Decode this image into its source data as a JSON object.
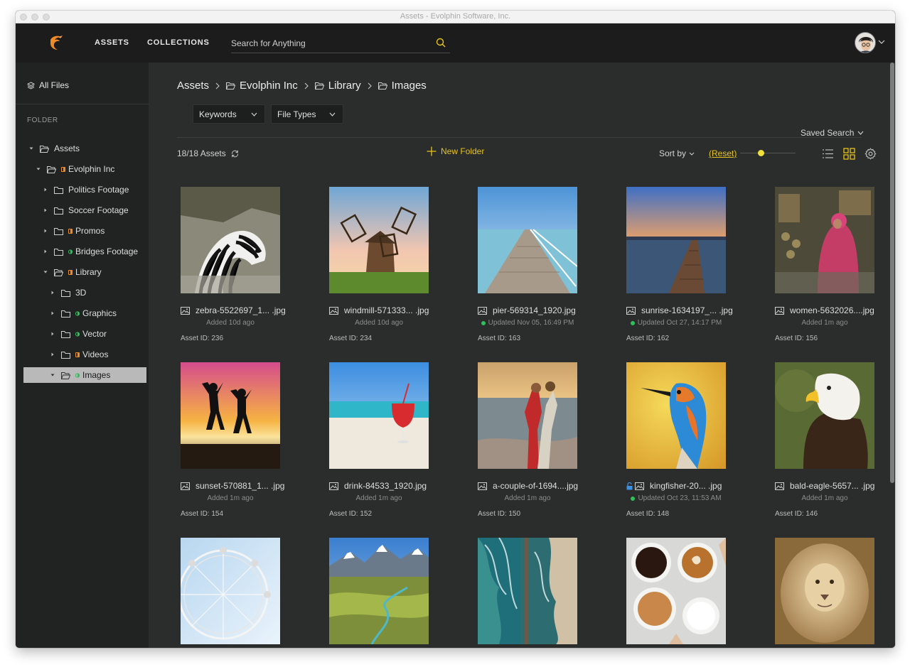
{
  "window": {
    "title": "Assets - Evolphin Software, Inc."
  },
  "nav": {
    "assets": "ASSETS",
    "collections": "COLLECTIONS"
  },
  "search": {
    "placeholder": "Search for Anything",
    "value": ""
  },
  "sidebar": {
    "all_files": "All Files",
    "folder_heading": "FOLDER",
    "tree": [
      {
        "label": "Assets",
        "level": 0,
        "expanded": true,
        "badge": ""
      },
      {
        "label": "Evolphin Inc",
        "level": 1,
        "expanded": true,
        "badge": "orange"
      },
      {
        "label": "Politics Footage",
        "level": 2,
        "expanded": false,
        "badge": ""
      },
      {
        "label": "Soccer Footage",
        "level": 2,
        "expanded": false,
        "badge": ""
      },
      {
        "label": "Promos",
        "level": 2,
        "expanded": false,
        "badge": "orange"
      },
      {
        "label": "Bridges Footage",
        "level": 2,
        "expanded": false,
        "badge": "green"
      },
      {
        "label": "Library",
        "level": 2,
        "expanded": true,
        "badge": "orange"
      },
      {
        "label": "3D",
        "level": 3,
        "expanded": false,
        "badge": ""
      },
      {
        "label": "Graphics",
        "level": 3,
        "expanded": false,
        "badge": "green"
      },
      {
        "label": "Vector",
        "level": 3,
        "expanded": false,
        "badge": "green"
      },
      {
        "label": "Videos",
        "level": 3,
        "expanded": false,
        "badge": "orange"
      },
      {
        "label": "Images",
        "level": 3,
        "expanded": true,
        "badge": "green",
        "selected": true
      }
    ]
  },
  "breadcrumb": [
    "Assets",
    "Evolphin Inc",
    "Library",
    "Images"
  ],
  "filters": {
    "keywords": "Keywords",
    "file_types": "File Types",
    "saved_search": "Saved Search"
  },
  "toolbar": {
    "asset_count": "18/18 Assets",
    "new_folder": "New Folder",
    "sort_by": "Sort by",
    "reset": "(Reset)",
    "thumb_size_level": 0.37,
    "active_view": "grid"
  },
  "colors": {
    "accent": "#e8c318",
    "status_green": "#2ec05a",
    "badge_orange": "#f08a24",
    "badge_green": "#2ec05a"
  },
  "assets": [
    {
      "name": "zebra-5522697_1... .jpg",
      "status": "Added 10d ago",
      "updated": false,
      "locked": false,
      "id": "Asset ID: 236",
      "thumb": "zebra"
    },
    {
      "name": "windmill-571333... .jpg",
      "status": "Added 10d ago",
      "updated": false,
      "locked": false,
      "id": "Asset ID: 234",
      "thumb": "windmill"
    },
    {
      "name": "pier-569314_1920.jpg",
      "status": "Updated Nov 05, 16:49 PM",
      "updated": true,
      "locked": false,
      "id": "Asset ID: 163",
      "thumb": "pier"
    },
    {
      "name": "sunrise-1634197_... .jpg",
      "status": "Updated Oct 27, 14:17 PM",
      "updated": true,
      "locked": false,
      "id": "Asset ID: 162",
      "thumb": "sunrise"
    },
    {
      "name": "women-5632026....jpg",
      "status": "Added 1m ago",
      "updated": false,
      "locked": false,
      "id": "Asset ID: 156",
      "thumb": "women"
    },
    {
      "name": "sunset-570881_1... .jpg",
      "status": "Added 1m ago",
      "updated": false,
      "locked": false,
      "id": "Asset ID: 154",
      "thumb": "sunset"
    },
    {
      "name": "drink-84533_1920.jpg",
      "status": "Added 1m ago",
      "updated": false,
      "locked": false,
      "id": "Asset ID: 152",
      "thumb": "drink"
    },
    {
      "name": "a-couple-of-1694....jpg",
      "status": "Added 1m ago",
      "updated": false,
      "locked": false,
      "id": "Asset ID: 150",
      "thumb": "couple"
    },
    {
      "name": "kingfisher-20... .jpg",
      "status": "Updated Oct 23, 11:53 AM",
      "updated": true,
      "locked": true,
      "id": "Asset ID: 148",
      "thumb": "kingfisher"
    },
    {
      "name": "bald-eagle-5657... .jpg",
      "status": "Added 1m ago",
      "updated": false,
      "locked": false,
      "id": "Asset ID: 146",
      "thumb": "eagle"
    },
    {
      "name": "",
      "status": "",
      "updated": false,
      "locked": false,
      "id": "",
      "thumb": "ferris"
    },
    {
      "name": "",
      "status": "",
      "updated": false,
      "locked": false,
      "id": "",
      "thumb": "valley"
    },
    {
      "name": "",
      "status": "",
      "updated": false,
      "locked": false,
      "id": "",
      "thumb": "beach-aerial"
    },
    {
      "name": "",
      "status": "",
      "updated": false,
      "locked": false,
      "id": "",
      "thumb": "coffee"
    },
    {
      "name": "",
      "status": "",
      "updated": false,
      "locked": false,
      "id": "",
      "thumb": "lion"
    }
  ]
}
